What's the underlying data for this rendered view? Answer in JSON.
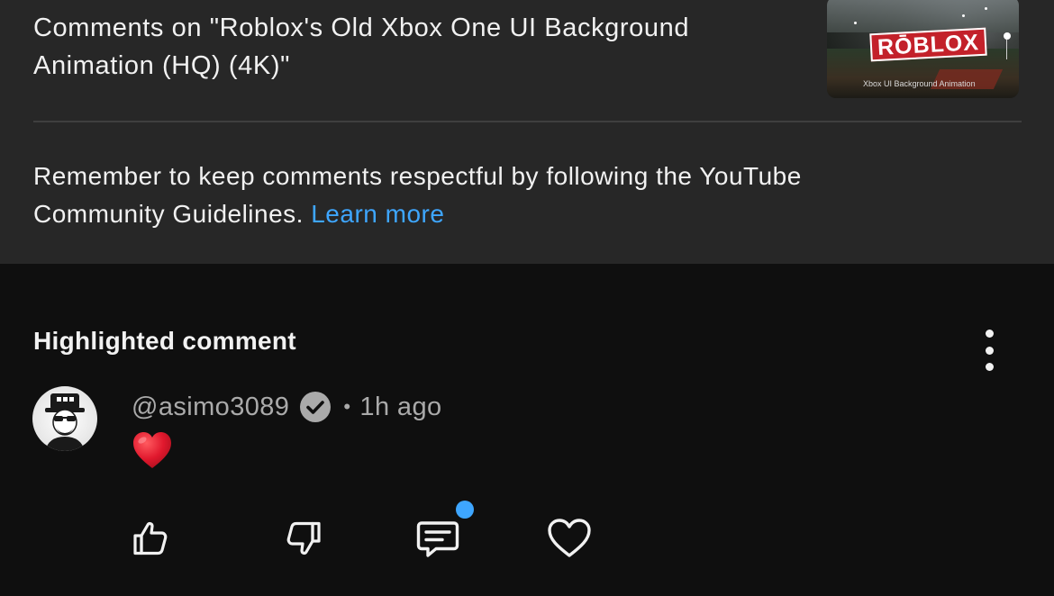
{
  "header": {
    "comments_title": "Comments on \"Roblox's Old Xbox One UI Background Animation (HQ) (4K)\"",
    "thumbnail": {
      "logo_text": "RŌBLOX",
      "caption": "Xbox UI Background Animation"
    }
  },
  "guidelines": {
    "text": "Remember to keep comments respectful by following the YouTube Community Guidelines.",
    "link_label": "Learn more",
    "link_color": "#3ea6ff"
  },
  "highlighted": {
    "heading": "Highlighted comment",
    "menu_icon": "more-vert-icon",
    "comment": {
      "author": "@asimo3089",
      "verified_icon": "verified-badge-icon",
      "separator": "•",
      "time": "1h ago",
      "body_icon": "red-heart-emoji"
    },
    "actions": [
      {
        "icon": "thumb-up-icon"
      },
      {
        "icon": "thumb-down-icon"
      },
      {
        "icon": "reply-icon",
        "has_notification": true
      },
      {
        "icon": "heart-icon"
      }
    ]
  },
  "colors": {
    "panel_bg": "#272727",
    "page_bg": "#0f0f0f",
    "text": "#f1f1f1",
    "secondary_text": "#aaaaaa",
    "accent": "#3ea6ff",
    "heart_red": "#e0182d"
  }
}
